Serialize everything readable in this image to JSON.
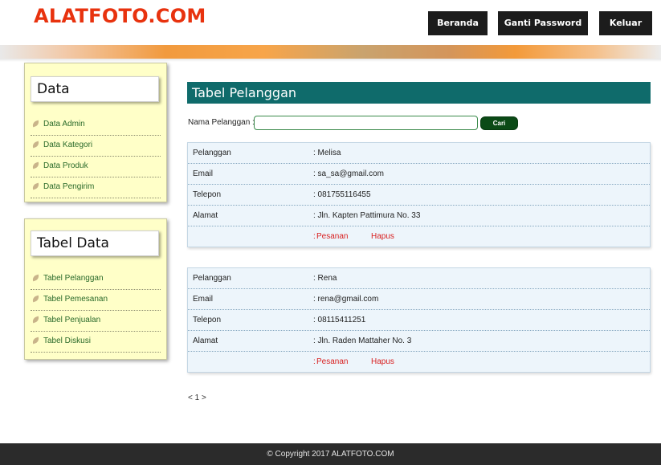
{
  "header": {
    "logo": "ALATFOTO.COM",
    "nav": [
      "Beranda",
      "Ganti Password",
      "Keluar"
    ]
  },
  "sidebar": {
    "data_title": "Data",
    "data_items": [
      "Data Admin",
      "Data Kategori",
      "Data Produk",
      "Data Pengirim"
    ],
    "tabel_title": "Tabel Data",
    "tabel_items": [
      "Tabel Pelanggan",
      "Tabel Pemesanan",
      "Tabel Penjualan",
      "Tabel Diskusi"
    ]
  },
  "main": {
    "title": "Tabel Pelanggan",
    "search_label": "Nama Pelanggan :",
    "search_value": "",
    "search_button": "Cari",
    "field_labels": {
      "pelanggan": "Pelanggan",
      "email": "Email",
      "telepon": "Telepon",
      "alamat": "Alamat"
    },
    "customers": [
      {
        "pelanggan": ": Melisa",
        "email": ": sa_sa@gmail.com",
        "telepon": ": 081755116455",
        "alamat": ": Jln. Kapten Pattimura No. 33",
        "action1": "Pesanan",
        "action2": "Hapus"
      },
      {
        "pelanggan": ": Rena",
        "email": ": rena@gmail.com",
        "telepon": ": 08115411251",
        "alamat": ": Jln. Raden Mattaher No. 3",
        "action1": "Pesanan",
        "action2": "Hapus"
      }
    ],
    "colon": ":",
    "pagination": "< 1 >"
  },
  "footer": {
    "text": "© Copyright 2017 ALATFOTO.COM"
  },
  "colors": {
    "logo": "#e8320e",
    "title_bar": "#0f6b6b",
    "sidebar_bg": "#ffffc8",
    "action_link": "#d82020",
    "search_button": "#0b4a16"
  }
}
